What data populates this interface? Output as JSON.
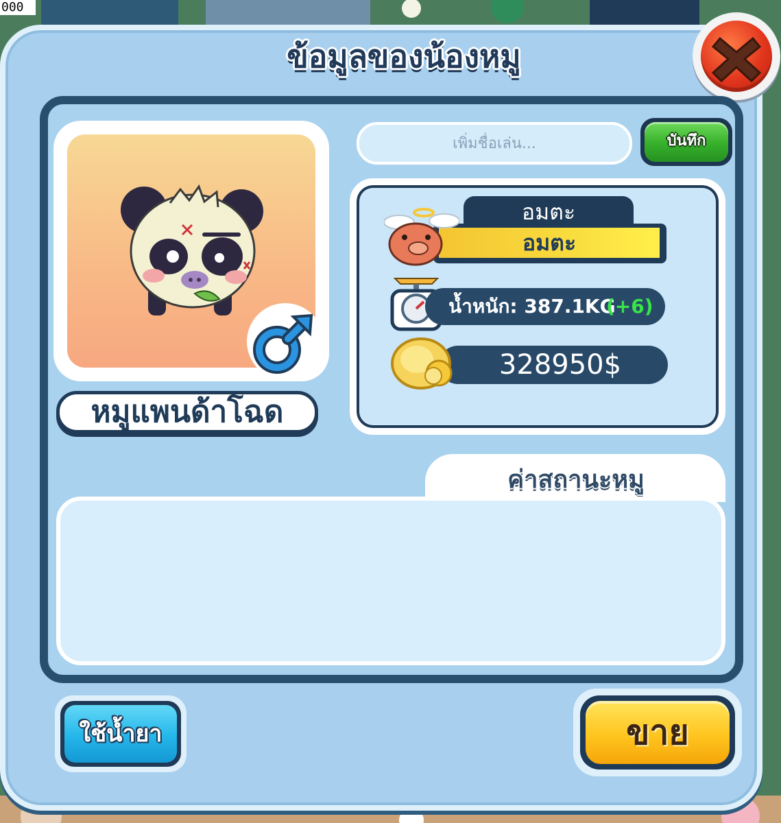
{
  "corner_counter": "000",
  "dialog": {
    "title": "ข้อมูลของน้องหมู",
    "close_icon": "close-x-icon"
  },
  "pig": {
    "name": "หมูแพนด้าโฉด",
    "gender": "male",
    "gender_icon": "male-symbol-icon",
    "portrait_icon": "panda-pig-icon"
  },
  "nickname": {
    "placeholder": "เพิ่มชื่อเล่น...",
    "value": "",
    "save_label": "บันทึก"
  },
  "status": {
    "tab_label": "อมตะ",
    "value": "อมตะ",
    "icon": "angel-pig-icon"
  },
  "weight": {
    "label": "น้ำหนัก: 387.1KG",
    "delta": "(+6)",
    "icon": "scale-icon"
  },
  "money": {
    "value": "328950$",
    "icon": "gold-coin-icon"
  },
  "stats": {
    "tab_label": "ค่าสถานะหมู"
  },
  "buttons": {
    "potion_label": "ใช้น้ำยา",
    "sell_label": "ขาย"
  },
  "colors": {
    "panel": "#a8d0ee",
    "dark_border": "#1f3b58",
    "save_green": "#36b02b",
    "sell_yellow": "#ffc51f",
    "potion_blue": "#24b6ea",
    "close_red": "#e2361d",
    "weight_delta": "#38e44a"
  }
}
